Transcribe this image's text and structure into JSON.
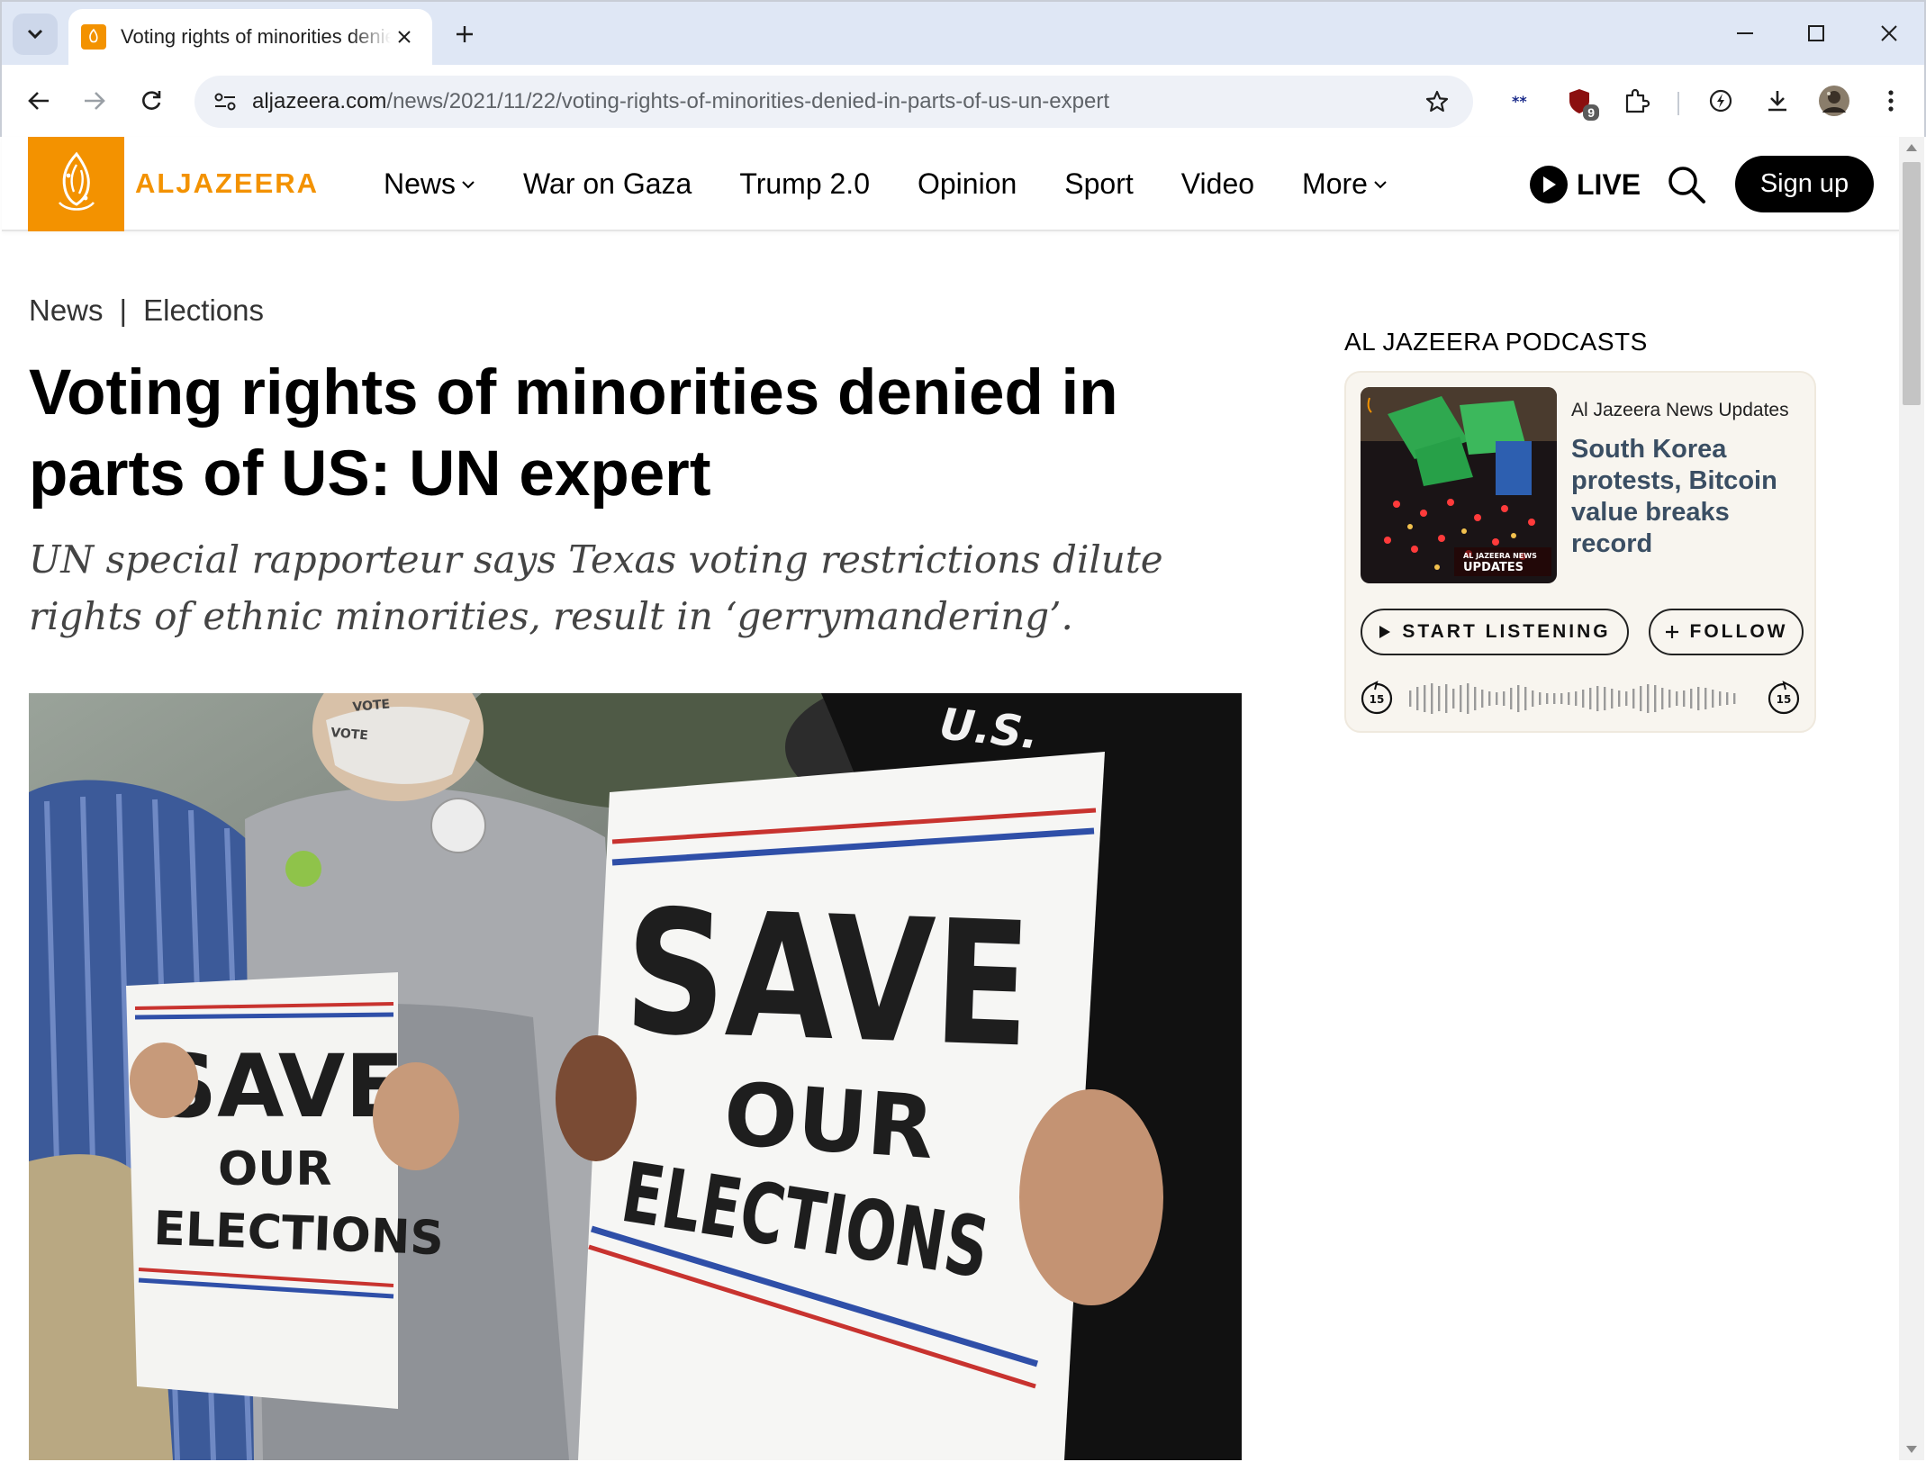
{
  "browser": {
    "tab_title": "Voting rights of minorities denied in parts of US: UN expert",
    "url_host": "aljazeera.com",
    "url_path": "/news/2021/11/22/voting-rights-of-minorities-denied-in-parts-of-us-un-expert",
    "extension_badge": "9"
  },
  "site": {
    "brand": "ALJAZEERA",
    "nav": [
      "News",
      "War on Gaza",
      "Trump 2.0",
      "Opinion",
      "Sport",
      "Video",
      "More"
    ],
    "live_label": "LIVE",
    "signup_label": "Sign up"
  },
  "article": {
    "breadcrumb": [
      "News",
      "Elections"
    ],
    "breadcrumb_sep": "|",
    "headline": "Voting rights of minorities denied in parts of US: UN expert",
    "dek": "UN special rapporteur says Texas voting restrictions dilute rights of ethnic minorities, result in ‘gerrymandering’.",
    "hero_sign_text": [
      "SAVE",
      "OUR",
      "ELECTIONS"
    ],
    "hero_shirt_text": "U.S."
  },
  "podcasts": {
    "heading": "AL JAZEERA PODCASTS",
    "show_name": "Al Jazeera News Updates",
    "episode_title": "South Korea protests, Bitcoin value breaks record",
    "thumb_label_small": "AL JAZEERA NEWS",
    "thumb_label_big": "UPDATES",
    "listen_label": "START LISTENING",
    "follow_label": "FOLLOW",
    "skip_seconds": "15"
  },
  "colors": {
    "brand_orange": "#f39200",
    "podcast_title": "#3a4e63",
    "chrome_bg": "#dfe7f5"
  }
}
